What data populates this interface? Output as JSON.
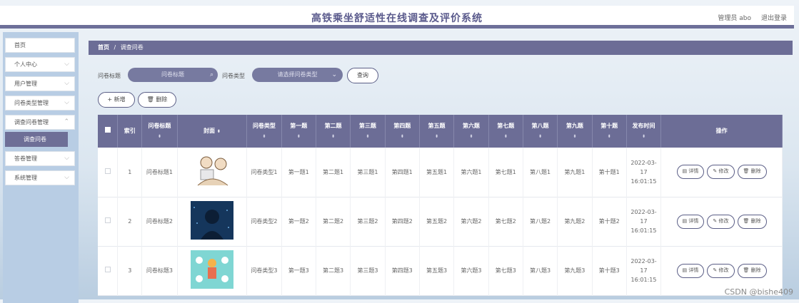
{
  "header": {
    "title": "高铁乘坐舒适性在线调查及评价系统",
    "admin": "管理员 abo",
    "logout": "退出登录"
  },
  "sidebar": {
    "items": [
      {
        "label": "首页",
        "chevron": false
      },
      {
        "label": "个人中心",
        "chevron": true
      },
      {
        "label": "用户管理",
        "chevron": true
      },
      {
        "label": "问卷类型管理",
        "chevron": true
      },
      {
        "label": "调查问卷管理",
        "chevron": true
      },
      {
        "label": "答卷管理",
        "chevron": true
      },
      {
        "label": "系统管理",
        "chevron": true
      }
    ],
    "sub_active": "调查问卷"
  },
  "breadcrumb": {
    "home": "首页",
    "sep": "/",
    "current": "调查问卷"
  },
  "search": {
    "title_label": "问卷标题",
    "title_placeholder": "问卷标题",
    "type_label": "问卷类型",
    "type_placeholder": "请选择问卷类型",
    "query_button": "查询"
  },
  "toolbar": {
    "add_button": "+ 新增",
    "delete_button": "删除"
  },
  "table": {
    "headers": [
      "索引",
      "问卷标题",
      "封面",
      "问卷类型",
      "第一题",
      "第二题",
      "第三题",
      "第四题",
      "第五题",
      "第六题",
      "第七题",
      "第八题",
      "第九题",
      "第十题",
      "发布时间",
      "操作"
    ],
    "rows": [
      {
        "index": "1",
        "title": "问卷标题1",
        "type": "问卷类型1",
        "q": [
          "第一题1",
          "第二题1",
          "第三题1",
          "第四题1",
          "第五题1",
          "第六题1",
          "第七题1",
          "第八题1",
          "第九题1",
          "第十题1"
        ],
        "time": "2022-03-17 16:01:15"
      },
      {
        "index": "2",
        "title": "问卷标题2",
        "type": "问卷类型2",
        "q": [
          "第一题2",
          "第二题2",
          "第三题2",
          "第四题2",
          "第五题2",
          "第六题2",
          "第七题2",
          "第八题2",
          "第九题2",
          "第十题2"
        ],
        "time": "2022-03-17 16:01:15"
      },
      {
        "index": "3",
        "title": "问卷标题3",
        "type": "问卷类型3",
        "q": [
          "第一题3",
          "第二题3",
          "第三题3",
          "第四题3",
          "第五题3",
          "第六题3",
          "第七题3",
          "第八题3",
          "第九题3",
          "第十题3"
        ],
        "time": "2022-03-17 16:01:15"
      }
    ],
    "actions": {
      "detail": "详情",
      "edit": "修改",
      "delete": "删除"
    }
  },
  "watermark": "CSDN @bishe409",
  "colors": {
    "accent": "#6c6d96",
    "sidebar_bg": "#b8cde4"
  }
}
